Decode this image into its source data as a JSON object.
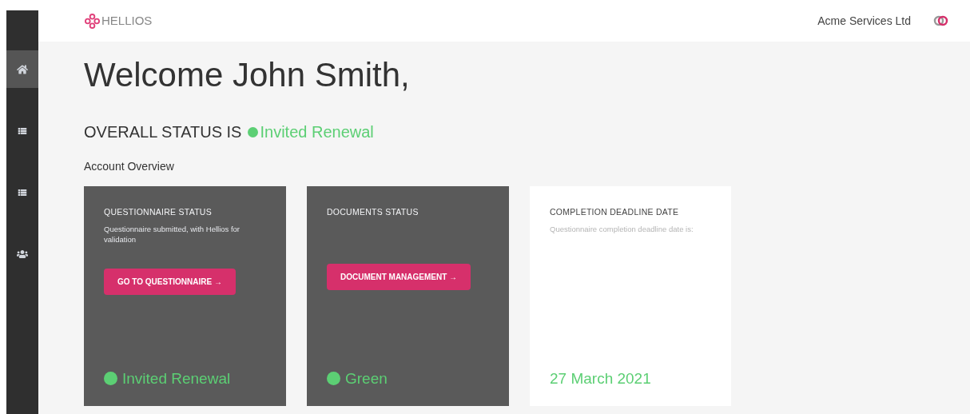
{
  "header": {
    "logo": "HELLIOS",
    "company": "Acme Services Ltd"
  },
  "sidebar": {
    "items": [
      {
        "kind": "home",
        "selected": true
      },
      {
        "kind": "list",
        "selected": false
      },
      {
        "kind": "list",
        "selected": false
      },
      {
        "kind": "users",
        "selected": false
      }
    ]
  },
  "welcome": "Welcome John Smith,",
  "overall_status": {
    "label": "OVERALL STATUS IS",
    "value": "Invited Renewal",
    "color": "#5ccf74"
  },
  "section_title": "Account Overview",
  "cards": [
    {
      "kind": "dark",
      "title": "QUESTIONNAIRE STATUS",
      "text": "Questionnaire submitted, with Hellios for validation",
      "button": "GO TO QUESTIONNAIRE →",
      "status": "Invited Renewal",
      "color": "#5ccf74"
    },
    {
      "kind": "dark",
      "title": "DOCUMENTS STATUS",
      "button": "DOCUMENT MANAGEMENT →",
      "status": "Green",
      "color": "#5ccf74"
    },
    {
      "kind": "light",
      "title": "COMPLETION DEADLINE DATE",
      "text": "Questionnaire completion deadline date is:",
      "date": "27 March 2021"
    }
  ]
}
